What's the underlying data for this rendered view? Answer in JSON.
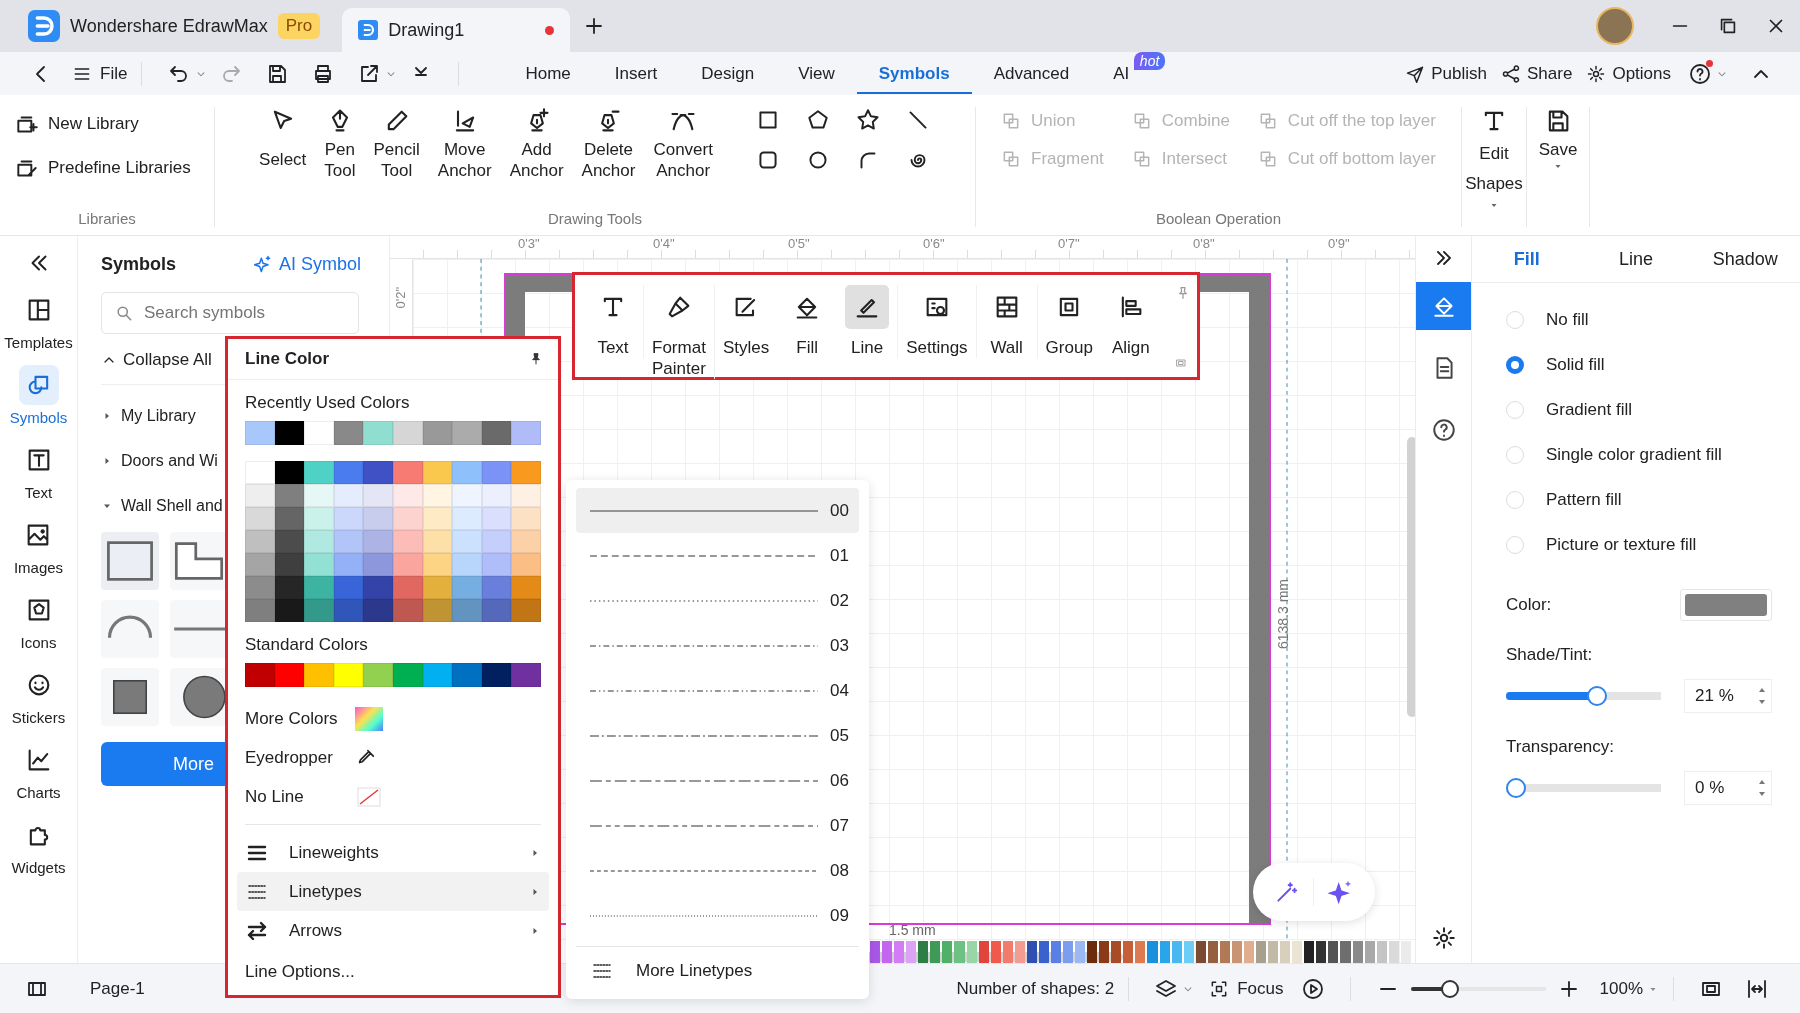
{
  "title_bar": {
    "app_title": "Wondershare EdrawMax",
    "badge": "Pro",
    "doc_tabs": [
      {
        "title": "Drawing1",
        "selected": true,
        "unsaved": true
      }
    ]
  },
  "menu_bar": {
    "file": "File",
    "tabs": [
      {
        "label": "Home",
        "selected": false
      },
      {
        "label": "Insert",
        "selected": false
      },
      {
        "label": "Design",
        "selected": false
      },
      {
        "label": "View",
        "selected": false
      },
      {
        "label": "Symbols",
        "selected": true
      },
      {
        "label": "Advanced",
        "selected": false
      },
      {
        "label": "AI",
        "selected": false,
        "badge": "hot"
      }
    ],
    "actions": [
      "Publish",
      "Share",
      "Options"
    ]
  },
  "ribbon": {
    "libraries": {
      "title": "Libraries",
      "items": [
        "New Library",
        "Predefine Libraries"
      ]
    },
    "drawing_tools": {
      "title": "Drawing Tools",
      "tools": [
        "Select",
        "Pen Tool",
        "Pencil Tool",
        "Move Anchor",
        "Add Anchor",
        "Delete Anchor",
        "Convert Anchor"
      ]
    },
    "boolean": {
      "title": "Boolean Operation",
      "disabled": true,
      "items": [
        "Union",
        "Combine",
        "Cut off the top layer",
        "Fragment",
        "Intersect",
        "Cut off bottom layer"
      ]
    },
    "edit_shapes": "Edit Shapes",
    "save": "Save"
  },
  "left_rail": [
    {
      "label": "Templates",
      "selected": false
    },
    {
      "label": "Symbols",
      "selected": true
    },
    {
      "label": "Text",
      "selected": false
    },
    {
      "label": "Images",
      "selected": false
    },
    {
      "label": "Icons",
      "selected": false
    },
    {
      "label": "Stickers",
      "selected": false
    },
    {
      "label": "Charts",
      "selected": false
    },
    {
      "label": "Widgets",
      "selected": false
    }
  ],
  "symbols_panel": {
    "title": "Symbols",
    "ai_button": "AI Symbol",
    "search": {
      "placeholder": "Search symbols"
    },
    "collapse_all": "Collapse All",
    "tree": [
      {
        "label": "My Library",
        "expanded": false
      },
      {
        "label": "Doors and Wi",
        "expanded": false
      },
      {
        "label": "Wall Shell and",
        "expanded": true
      }
    ],
    "more_button": "More"
  },
  "canvas": {
    "ruler_top": [
      "0'3\"",
      "0'4\"",
      "0'5\"",
      "0'6\"",
      "0'7\"",
      "0'8\"",
      "0'9\""
    ],
    "ruler_left": [
      "0'2\""
    ],
    "dimension_horizontal": "1.5 mm",
    "dimension_vertical": "6138.3 mm",
    "color_strip": [
      {
        "color": "#a958e8"
      },
      {
        "color": "#c266f0"
      },
      {
        "color": "#d27cf5"
      },
      {
        "color": "#dca2f5"
      },
      {
        "color": "#2e7d46"
      },
      {
        "color": "#3e9a55"
      },
      {
        "color": "#4fb068"
      },
      {
        "color": "#6cc183"
      },
      {
        "color": "#98d6a8"
      },
      {
        "color": "#e0443b"
      },
      {
        "color": "#ef5a4c"
      },
      {
        "color": "#f27b6e"
      },
      {
        "color": "#f59c92"
      },
      {
        "color": "#2f50b0"
      },
      {
        "color": "#3a62cf"
      },
      {
        "color": "#5a80e6"
      },
      {
        "color": "#7c9cee"
      },
      {
        "color": "#9bb8f3"
      },
      {
        "color": "#6b2c0c"
      },
      {
        "color": "#8a3a16"
      },
      {
        "color": "#a84b26"
      },
      {
        "color": "#c55f39"
      },
      {
        "color": "#dd7a52"
      },
      {
        "color": "#1a8fdc"
      },
      {
        "color": "#2aa4ea"
      },
      {
        "color": "#48b9f0"
      },
      {
        "color": "#6dcdf5"
      },
      {
        "color": "#7a4a33"
      },
      {
        "color": "#94603f"
      },
      {
        "color": "#b07a57"
      },
      {
        "color": "#c99474"
      },
      {
        "color": "#e0ae8e"
      },
      {
        "color": "#a8a08e"
      },
      {
        "color": "#c2baa6"
      },
      {
        "color": "#d8d0bc"
      },
      {
        "color": "#ece4d2"
      },
      {
        "color": "#222222"
      },
      {
        "color": "#333333"
      },
      {
        "color": "#555555"
      },
      {
        "color": "#6e6e6e"
      },
      {
        "color": "#8a8a8a"
      },
      {
        "color": "#a8a8a8"
      },
      {
        "color": "#c4c4c4"
      },
      {
        "color": "#dadada"
      },
      {
        "color": "#ebebeb"
      }
    ]
  },
  "floating_toolbar": [
    {
      "label": "Text",
      "selected": false
    },
    {
      "label": "Format Painter",
      "selected": false
    },
    {
      "label": "Styles",
      "selected": false
    },
    {
      "label": "Fill",
      "selected": false
    },
    {
      "label": "Line",
      "selected": true
    },
    {
      "label": "Settings",
      "selected": false
    },
    {
      "label": "Wall",
      "selected": false
    },
    {
      "label": "Group",
      "selected": false
    },
    {
      "label": "Align",
      "selected": false
    }
  ],
  "line_color_popup": {
    "title": "Line Color",
    "recent_title": "Recently Used Colors",
    "recent": [
      {
        "color": "#a8c7fa"
      },
      {
        "color": "#000000"
      },
      {
        "color": "#ffffff"
      },
      {
        "color": "#898989"
      },
      {
        "color": "#8fded0"
      },
      {
        "color": "#d6d6d6"
      },
      {
        "color": "#999999"
      },
      {
        "color": "#ababab"
      },
      {
        "color": "#6a6a6a"
      },
      {
        "color": "#b0bcf8"
      }
    ],
    "theme_grid": [
      [
        {
          "color": "#ffffff"
        },
        {
          "color": "#000000"
        },
        {
          "color": "#4fd1c5"
        },
        {
          "color": "#4a7cf0"
        },
        {
          "color": "#3f51c4"
        },
        {
          "color": "#f77b72"
        },
        {
          "color": "#fbc84e"
        },
        {
          "color": "#8ec1fb"
        },
        {
          "color": "#7b93f6"
        },
        {
          "color": "#f99a1f"
        }
      ],
      [
        {
          "color": "#eeeeee"
        },
        {
          "color": "#7f7f7f"
        },
        {
          "color": "#e6f8f5"
        },
        {
          "color": "#e5ecfd"
        },
        {
          "color": "#e4e6f6"
        },
        {
          "color": "#fee9e8"
        },
        {
          "color": "#fff5e2"
        },
        {
          "color": "#eef5fe"
        },
        {
          "color": "#eceffe"
        },
        {
          "color": "#fef0e2"
        }
      ],
      [
        {
          "color": "#d9d9d9"
        },
        {
          "color": "#656565"
        },
        {
          "color": "#cbf1eb"
        },
        {
          "color": "#cbd8fb"
        },
        {
          "color": "#c8cdee"
        },
        {
          "color": "#fdd3d0"
        },
        {
          "color": "#feeac5"
        },
        {
          "color": "#dcebfd"
        },
        {
          "color": "#d9dffd"
        },
        {
          "color": "#fde1c5"
        }
      ],
      [
        {
          "color": "#bfbfbf"
        },
        {
          "color": "#4c4c4c"
        },
        {
          "color": "#b0e9e1"
        },
        {
          "color": "#b1c5f9"
        },
        {
          "color": "#adb4e5"
        },
        {
          "color": "#fcbdb8"
        },
        {
          "color": "#fde0a8"
        },
        {
          "color": "#cbe1fd"
        },
        {
          "color": "#c5cffb"
        },
        {
          "color": "#fcd1a8"
        }
      ],
      [
        {
          "color": "#a5a5a5"
        },
        {
          "color": "#3f3f3f"
        },
        {
          "color": "#93e0d5"
        },
        {
          "color": "#94b0f7"
        },
        {
          "color": "#8d97dc"
        },
        {
          "color": "#fba59f"
        },
        {
          "color": "#fcd483"
        },
        {
          "color": "#b8d6fc"
        },
        {
          "color": "#afbdfa"
        },
        {
          "color": "#fbbf85"
        }
      ],
      [
        {
          "color": "#8c8c8c"
        },
        {
          "color": "#262626"
        },
        {
          "color": "#3db3a2"
        },
        {
          "color": "#3866d9"
        },
        {
          "color": "#3443a8"
        },
        {
          "color": "#e06860"
        },
        {
          "color": "#e3b03d"
        },
        {
          "color": "#75aee0"
        },
        {
          "color": "#687fdb"
        },
        {
          "color": "#e38a18"
        }
      ],
      [
        {
          "color": "#7f7f7f"
        },
        {
          "color": "#191919"
        },
        {
          "color": "#33998b"
        },
        {
          "color": "#2f56b8"
        },
        {
          "color": "#2b388c"
        },
        {
          "color": "#bf5851"
        },
        {
          "color": "#c09433"
        },
        {
          "color": "#6394c0"
        },
        {
          "color": "#5569bb"
        },
        {
          "color": "#c17514"
        }
      ]
    ],
    "standard_title": "Standard Colors",
    "standard": [
      {
        "color": "#c00000"
      },
      {
        "color": "#ff0000"
      },
      {
        "color": "#ffc000"
      },
      {
        "color": "#ffff00"
      },
      {
        "color": "#92d050"
      },
      {
        "color": "#00b050"
      },
      {
        "color": "#00b0f0"
      },
      {
        "color": "#0070c0"
      },
      {
        "color": "#002060"
      },
      {
        "color": "#7030a0"
      }
    ],
    "more_colors": "More Colors",
    "eyedropper": "Eyedropper",
    "no_line": "No Line",
    "submenus": [
      {
        "label": "Lineweights",
        "selected": false
      },
      {
        "label": "Linetypes",
        "selected": true
      },
      {
        "label": "Arrows",
        "selected": false
      }
    ],
    "line_options": "Line Options..."
  },
  "linetypes_menu": {
    "items": [
      {
        "code": "00",
        "kind": "solid",
        "selected": true
      },
      {
        "code": "01",
        "kind": "dashed",
        "selected": false
      },
      {
        "code": "02",
        "kind": "dotted",
        "selected": false
      },
      {
        "code": "03",
        "kind": "dashdot",
        "selected": false
      },
      {
        "code": "04",
        "kind": "dashdotdot",
        "selected": false
      },
      {
        "code": "05",
        "kind": "longdashdot",
        "selected": false
      },
      {
        "code": "06",
        "kind": "longshort",
        "selected": false
      },
      {
        "code": "07",
        "kind": "longshortshort",
        "selected": false
      },
      {
        "code": "08",
        "kind": "shortdash",
        "selected": false
      },
      {
        "code": "09",
        "kind": "finedot",
        "selected": false
      }
    ],
    "more": "More Linetypes"
  },
  "right_rail": [
    {
      "selected": true
    },
    {
      "selected": false
    },
    {
      "selected": false
    }
  ],
  "format_panel": {
    "tabs": [
      {
        "label": "Fill",
        "selected": true
      },
      {
        "label": "Line",
        "selected": false
      },
      {
        "label": "Shadow",
        "selected": false
      }
    ],
    "fill_options": [
      {
        "label": "No fill",
        "selected": false
      },
      {
        "label": "Solid fill",
        "selected": true
      },
      {
        "label": "Gradient fill",
        "selected": false
      },
      {
        "label": "Single color gradient fill",
        "selected": false
      },
      {
        "label": "Pattern fill",
        "selected": false
      },
      {
        "label": "Picture or texture fill",
        "selected": false
      }
    ],
    "color": {
      "label": "Color:",
      "color": "#808080"
    },
    "shade_tint": {
      "label": "Shade/Tint:",
      "level": 0.6,
      "value": "21 %"
    },
    "transparency": {
      "label": "Transparency:",
      "level": 0,
      "value": "0 %"
    }
  },
  "status_bar": {
    "page": "Page-1",
    "shape_count": "Number of shapes: 2",
    "focus": "Focus",
    "zoom": {
      "level": 0.26,
      "value": "100%"
    }
  }
}
